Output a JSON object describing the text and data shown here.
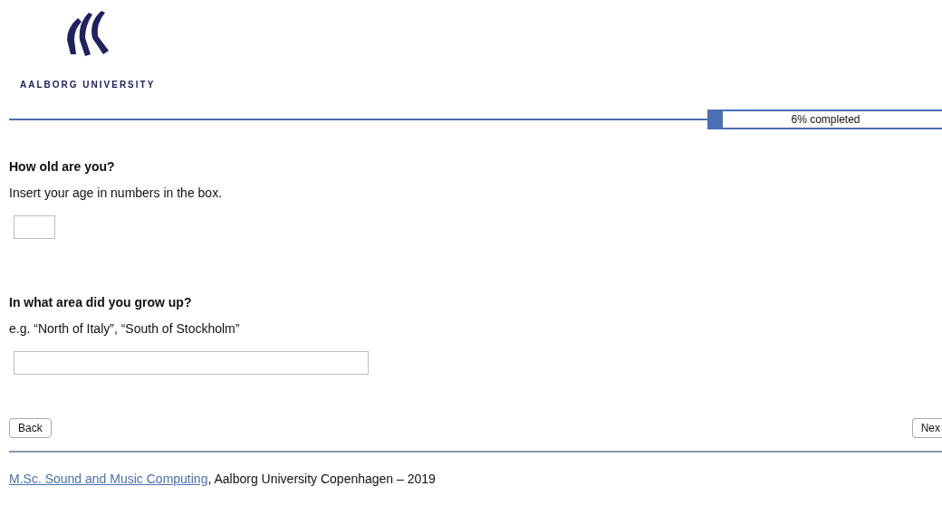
{
  "header": {
    "logo_text": "AALBORG UNIVERSITY"
  },
  "progress": {
    "level": 0.06,
    "label": "6% completed"
  },
  "questions": [
    {
      "title": "How old are you?",
      "hint": "Insert your age in numbers in the box.",
      "kind": "short"
    },
    {
      "title": "In what area did you grow up?",
      "hint": "e.g. “North of Italy”, “South of Stockholm”",
      "kind": "long"
    }
  ],
  "buttons": {
    "back": "Back",
    "next": "Nex"
  },
  "footer": {
    "link": "M.Sc. Sound and Music Computing",
    "text": ", Aalborg University Copenhagen – 2019"
  }
}
